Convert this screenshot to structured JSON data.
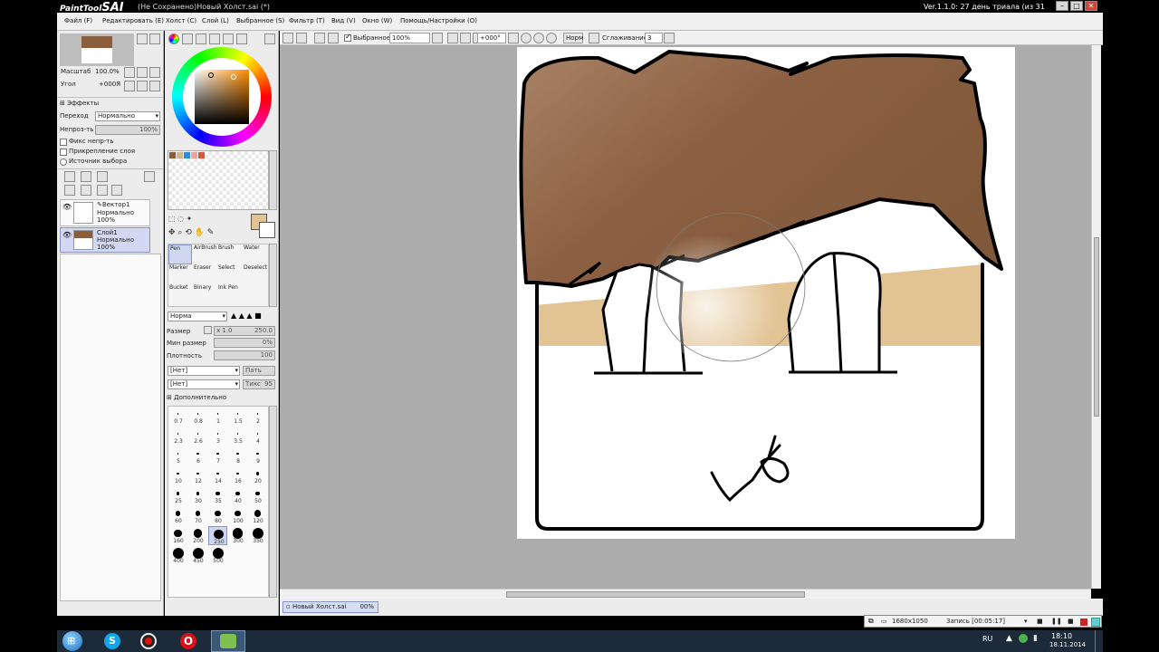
{
  "window": {
    "app_logo": "PaintTool",
    "app_logo_suffix": "SAI",
    "title": "(Не Сохранено)Новый Холст.sai (*)",
    "version_text": "Ver.1.1.0: 27 день триала (из 31"
  },
  "menu": [
    "Файл",
    "Редактировать",
    "Холст",
    "Слой",
    "Выбранное",
    "Фильтр",
    "Вид",
    "Окно",
    "Помощь/Настройки"
  ],
  "menu_keys": [
    "(F)",
    "(E)",
    "(C)",
    "(L)",
    "(S)",
    "(T)",
    "(V)",
    "(W)",
    "(O)"
  ],
  "toolbar": {
    "selection_checkbox": "Выбранное",
    "zoom_value": "100%",
    "angle_value": "+000°",
    "mode_button": "Норм",
    "smoothing_label": "Сглаживание",
    "smoothing_value": "3"
  },
  "navigator": {
    "scale_label": "Масштаб",
    "scale_value": "100.0%",
    "angle_label": "Угол",
    "angle_value": "+000Я"
  },
  "layer_props": {
    "effects_label": "Эффекты",
    "blend_label": "Переход",
    "blend_value": "Нормально",
    "opacity_label": "Непроз-ть",
    "opacity_value": "100%",
    "checkbox_1": "Фикс непр-ть",
    "checkbox_2": "Прикрепление слоя",
    "checkbox_3": "Источник выбора"
  },
  "layers": [
    {
      "name": "Вектор1",
      "mode": "Нормально",
      "opacity": "100%"
    },
    {
      "name": "Слой1",
      "mode": "Нормально",
      "opacity": "100%"
    }
  ],
  "tools": [
    {
      "label": "Pen"
    },
    {
      "label": "AirBrush"
    },
    {
      "label": "Brush"
    },
    {
      "label": "Water"
    },
    {
      "label": "Marker"
    },
    {
      "label": "Eraser"
    },
    {
      "label": "Select"
    },
    {
      "label": "Deselect"
    },
    {
      "label": "Bucket"
    },
    {
      "label": "Binary"
    },
    {
      "label": "Ink Pen"
    }
  ],
  "brush_settings": {
    "mode_value": "Норма",
    "size_label": "Размер",
    "size_multiplier": "x 1.0",
    "size_value": "250.0",
    "min_size_label": "Мин размер",
    "min_size_value": "0%",
    "density_label": "Плотность",
    "density_value": "100",
    "texture_1": "[Нет]",
    "texture_1_side": "Пать",
    "texture_2": "[Нет]",
    "texture_2_side": "Тикс",
    "texture_2_side_value": "95",
    "advanced_label": "Дополнительно"
  },
  "brush_sizes": [
    "0.7",
    "0.8",
    "1",
    "1.5",
    "2",
    "2.3",
    "2.6",
    "3",
    "3.5",
    "4",
    "5",
    "6",
    "7",
    "8",
    "9",
    "10",
    "12",
    "14",
    "16",
    "20",
    "25",
    "30",
    "35",
    "40",
    "50",
    "60",
    "70",
    "80",
    "100",
    "120",
    "160",
    "200",
    "250",
    "300",
    "350",
    "400",
    "450",
    "500"
  ],
  "selected_brush_size": "250",
  "status": {
    "doc_tab_name": "Новый Холст.sai",
    "doc_tab_zoom": "00%"
  },
  "recorder": {
    "resolution": "1680x1050",
    "record_label": "Запись [00:05:17]"
  },
  "taskbar": {
    "lang": "RU",
    "time": "18:10",
    "date": "18.11.2014"
  },
  "colors": {
    "hair": "#8a5e3c",
    "skin": "#e2c394",
    "selected_color": "#e2c394",
    "palette": [
      "#8a5e3c",
      "#d4b58c",
      "#2a8fd8",
      "#e8a8a0",
      "#d05a3a"
    ]
  }
}
